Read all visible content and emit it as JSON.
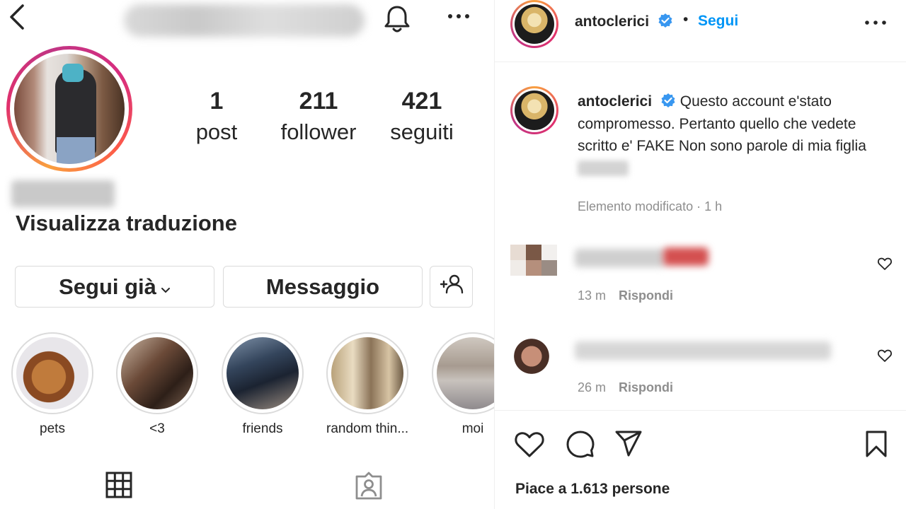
{
  "profile": {
    "stats": [
      {
        "value": "1",
        "label": "post"
      },
      {
        "value": "211",
        "label": "follower"
      },
      {
        "value": "421",
        "label": "seguiti"
      }
    ],
    "translate_label": "Visualizza traduzione",
    "follow_button": "Segui già",
    "message_button": "Messaggio",
    "highlights": [
      "pets",
      "<3",
      "friends",
      "random thin...",
      "moi"
    ]
  },
  "post": {
    "author": "antoclerici",
    "dot": "•",
    "follow_label": "Segui",
    "caption_text": "Questo account e'stato compromesso. Pertanto quello che vedete scritto e' FAKE Non sono parole di mia figlia",
    "edited_label": "Elemento modificato · 1 h",
    "comments": [
      {
        "time": "13 m",
        "reply_label": "Rispondi"
      },
      {
        "time": "26 m",
        "reply_label": "Rispondi"
      }
    ],
    "likes_label": "Piace a 1.613 persone"
  },
  "colors": {
    "link_blue": "#0095f6",
    "verified_blue": "#3897f0",
    "muted_text": "#8e8e8e"
  }
}
